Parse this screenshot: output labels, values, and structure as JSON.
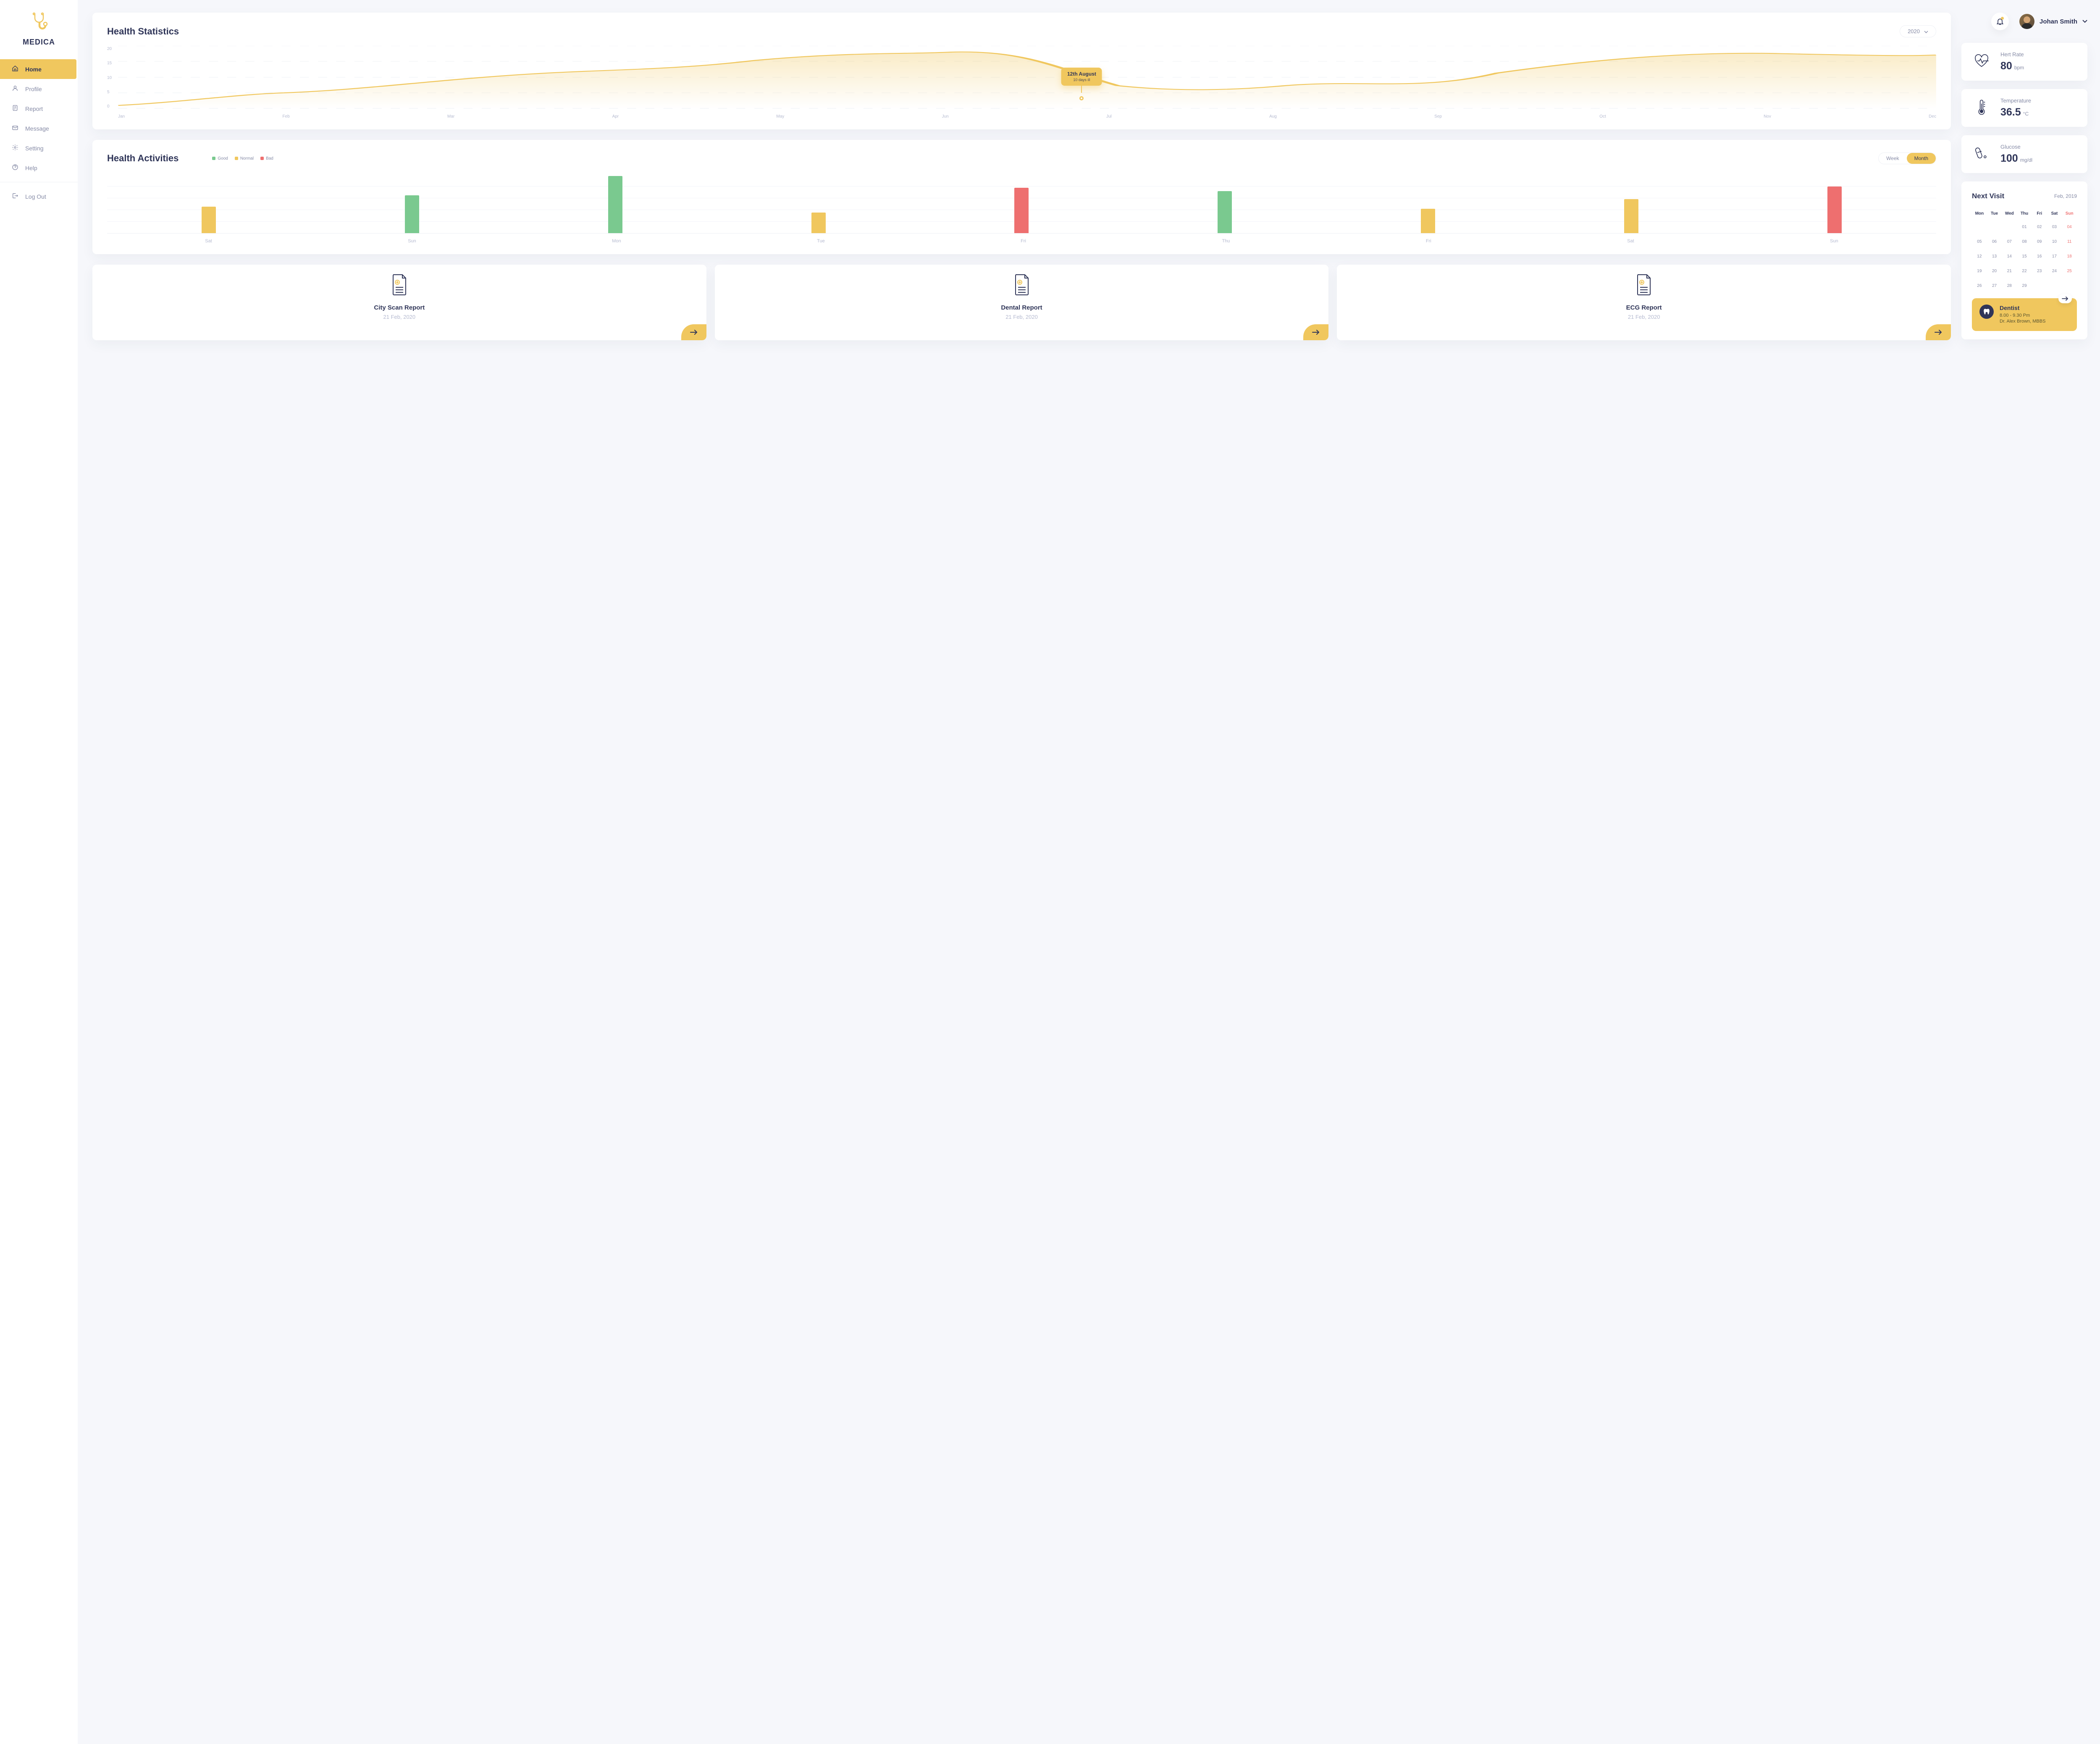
{
  "brand": "MEDICA",
  "nav": {
    "home": "Home",
    "profile": "Profile",
    "report": "Report",
    "message": "Message",
    "setting": "Setting",
    "help": "Help",
    "logout": "Log Out"
  },
  "user": {
    "name": "Johan Smith"
  },
  "stats": {
    "title": "Health Statistics",
    "year": "2020",
    "y_ticks": [
      "20",
      "15",
      "10",
      "5",
      "0"
    ],
    "x_ticks": [
      "Jan",
      "Feb",
      "Mar",
      "Apr",
      "May",
      "Jun",
      "Jul",
      "Aug",
      "Sep",
      "Oct",
      "Nov",
      "Dec"
    ],
    "tooltip": {
      "date": "12th August",
      "sub": "10 days ill"
    }
  },
  "activities": {
    "title": "Health Activities",
    "legend": {
      "good": "Good",
      "normal": "Normal",
      "bad": "Bad"
    },
    "toggle": {
      "week": "Week",
      "month": "Month"
    },
    "labels": [
      "Sat",
      "Sun",
      "Mon",
      "Tue",
      "Fri",
      "Thu",
      "Fri",
      "Sat",
      "Sun"
    ]
  },
  "reports": {
    "r1": {
      "title": "City Scan Report",
      "date": "21 Feb, 2020"
    },
    "r2": {
      "title": "Dental Report",
      "date": "21 Feb, 2020"
    },
    "r3": {
      "title": "ECG Report",
      "date": "21 Feb, 2020"
    }
  },
  "metrics": {
    "heart": {
      "label": "Hert Rate",
      "val": "80",
      "unit": "bpm"
    },
    "temp": {
      "label": "Temperature",
      "val": "36.5",
      "unit": "°C"
    },
    "glucose": {
      "label": "Glucose",
      "val": "100",
      "unit": "mg/dl"
    }
  },
  "calendar": {
    "title": "Next Visit",
    "month": "Feb, 2019",
    "dow": [
      "Mon",
      "Tue",
      "Wed",
      "Thu",
      "Fri",
      "Sat",
      "Sun"
    ]
  },
  "appointment": {
    "title": "Dentist",
    "time": "8.00 - 9.30 Pm",
    "doctor": "Dr. Alex Brown, MBBS"
  },
  "chart_data": [
    {
      "type": "line",
      "title": "Health Statistics",
      "x": [
        "Jan",
        "Feb",
        "Mar",
        "Apr",
        "May",
        "Jun",
        "Jul",
        "Aug",
        "Sep",
        "Oct",
        "Nov",
        "Dec"
      ],
      "values": [
        1,
        5,
        9,
        12,
        16,
        18,
        9,
        7,
        6,
        11,
        18,
        17
      ],
      "ylim": [
        0,
        20
      ],
      "ylabel": "",
      "tooltip": {
        "x": "12th August",
        "note": "10 days ill"
      }
    },
    {
      "type": "bar",
      "title": "Health Activities",
      "categories": [
        "Sat",
        "Sun",
        "Mon",
        "Tue",
        "Fri",
        "Thu",
        "Fri",
        "Sat",
        "Sun"
      ],
      "series": [
        {
          "name": "value",
          "values": [
            45,
            65,
            98,
            35,
            78,
            72,
            42,
            58,
            80
          ]
        },
        {
          "name": "status",
          "values": [
            "Normal",
            "Good",
            "Good",
            "Normal",
            "Bad",
            "Good",
            "Normal",
            "Normal",
            "Bad"
          ]
        }
      ],
      "legend": [
        "Good",
        "Normal",
        "Bad"
      ],
      "colors": {
        "Good": "#7ac98f",
        "Normal": "#f0c75e",
        "Bad": "#ee6f6f"
      },
      "ylim": [
        0,
        100
      ]
    }
  ]
}
